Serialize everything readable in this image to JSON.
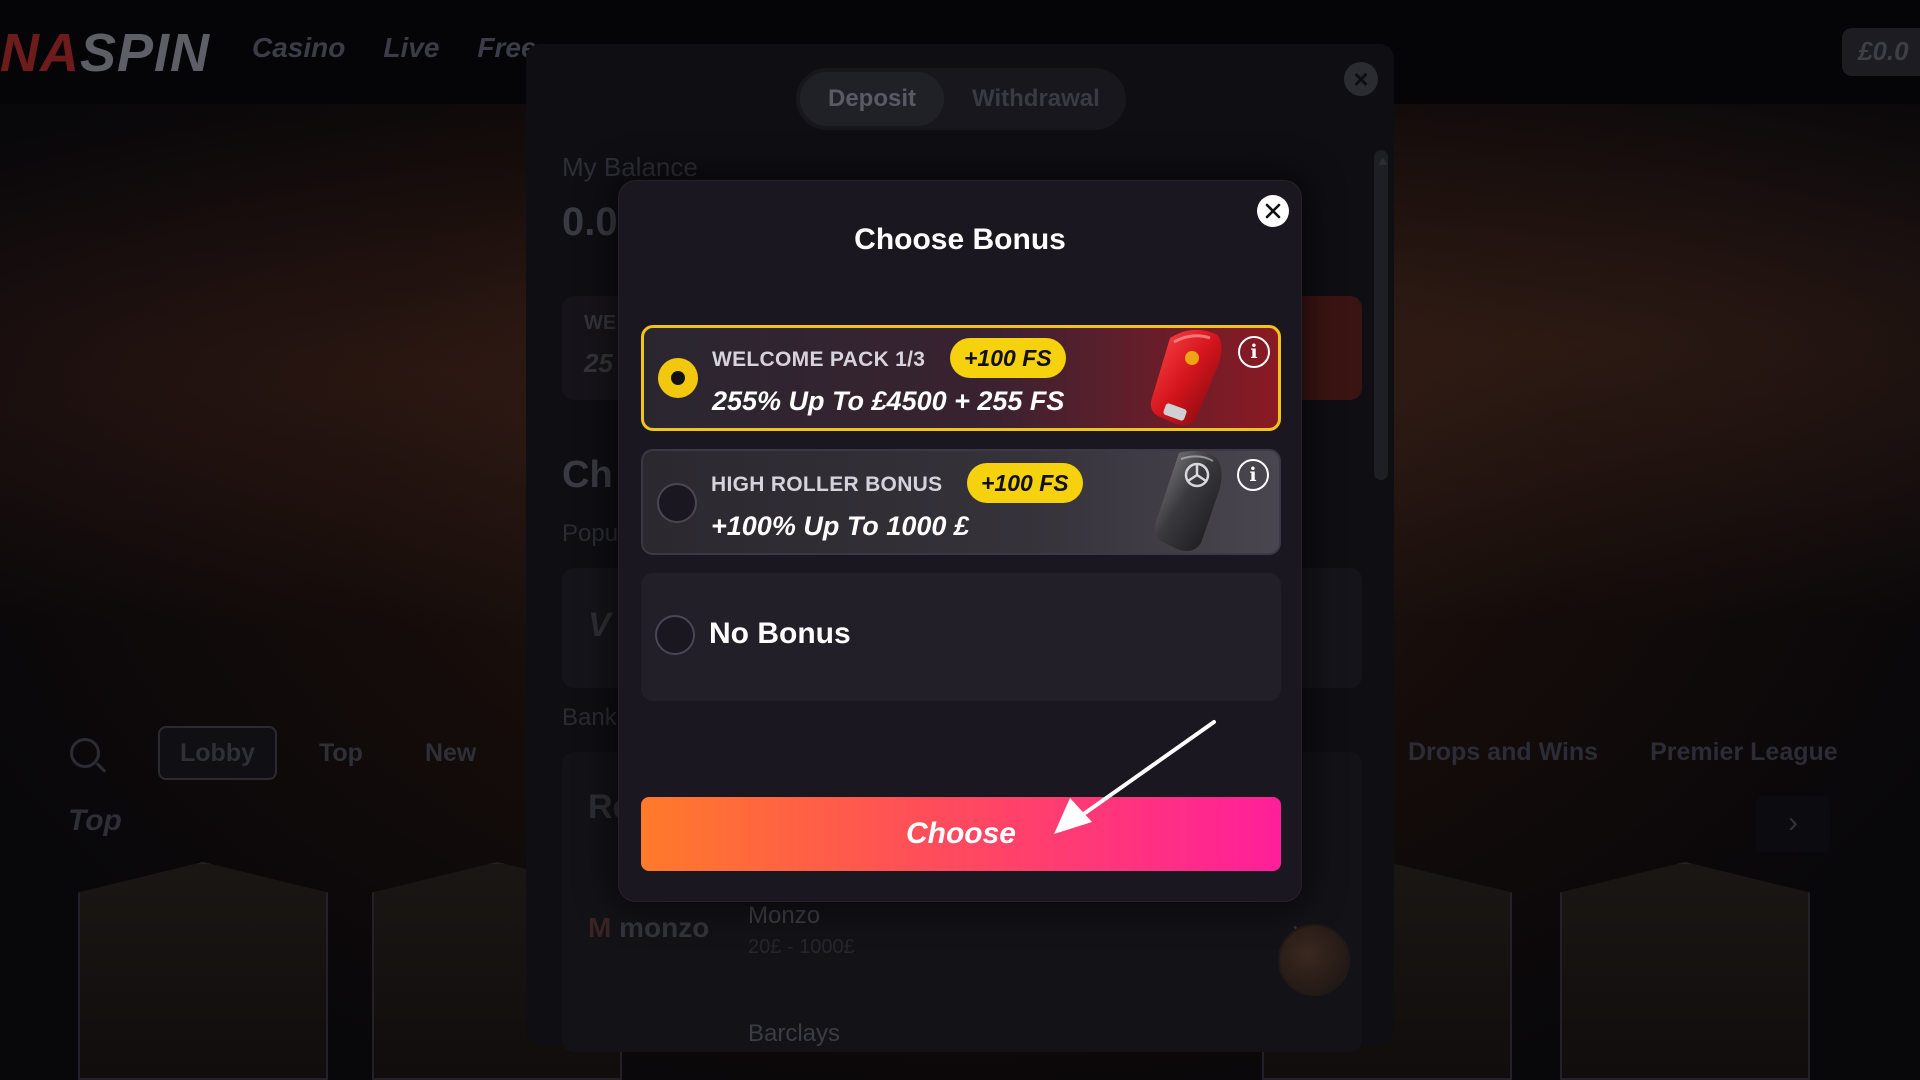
{
  "site": {
    "logo_prefix": "NA",
    "logo_main": "SPIN",
    "nav": [
      "Casino",
      "Live",
      "Free"
    ],
    "header_balance": "£0.0",
    "filters": [
      "Lobby",
      "Top",
      "New"
    ],
    "filters_right": [
      "Drops and Wins",
      "Premier League"
    ],
    "section_title": "Top",
    "next_arrow": "›"
  },
  "deposit": {
    "tabs": {
      "deposit": "Deposit",
      "withdrawal": "Withdrawal"
    },
    "close": "×",
    "balance_label": "My Balance",
    "balance_value": "0.0",
    "bonus_box_line1": "WE",
    "bonus_box_line2": "25",
    "choose_heading": "Ch",
    "popular_label": "Popu",
    "payment_initial": "V",
    "bank_label": "Bank",
    "list_heading": "Re",
    "payments": [
      {
        "logo": "monzo",
        "name": "Monzo",
        "range": "20£ - 1000£"
      },
      {
        "name": "Barclays"
      }
    ],
    "chevron": "›"
  },
  "modal": {
    "title": "Choose Bonus",
    "bonuses": [
      {
        "name": "WELCOME PACK 1/3",
        "fs": "+100 FS",
        "offer": "255% Up To £4500 + 255 FS",
        "selected": true,
        "key_color": "#d4141c",
        "key_icon": "ferrari-key-icon"
      },
      {
        "name": "HIGH ROLLER BONUS",
        "fs": "+100 FS",
        "offer": "+100% Up To 1000 £",
        "selected": false,
        "key_color": "#3a3a3e",
        "key_icon": "mercedes-key-icon"
      }
    ],
    "no_bonus": "No Bonus",
    "info_symbol": "i",
    "choose_label": "Choose"
  },
  "colors": {
    "accent_yellow": "#f5d20d",
    "button_gradient_start": "#ff7a2a",
    "button_gradient_end": "#ff1f9a",
    "modal_bg": "#1a1720"
  }
}
